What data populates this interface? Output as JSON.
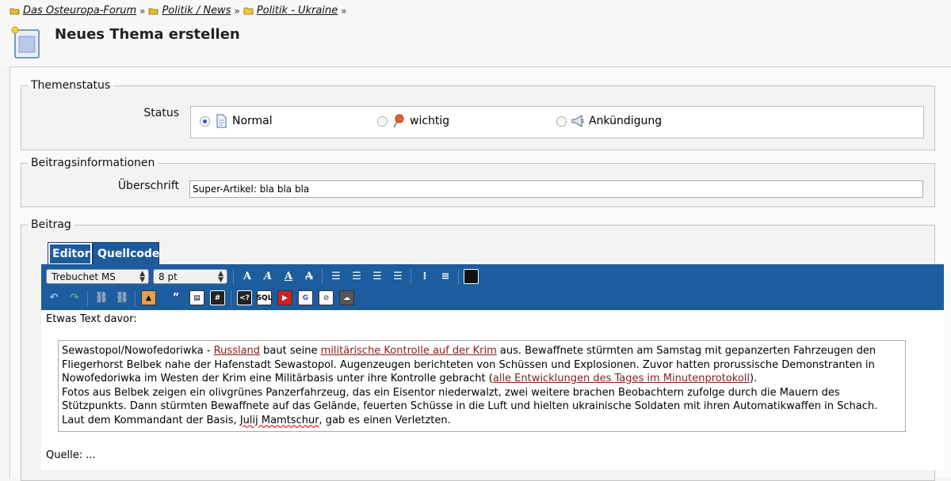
{
  "breadcrumb": {
    "items": [
      "Das Osteuropa-Forum",
      "Politik / News",
      "Politik - Ukraine"
    ],
    "separator": "»"
  },
  "page_title": "Neues Thema erstellen",
  "themenstatus": {
    "legend": "Themenstatus",
    "status_label": "Status",
    "options": [
      {
        "label": "Normal",
        "icon": "document-icon",
        "selected": true
      },
      {
        "label": "wichtig",
        "icon": "pin-icon",
        "selected": false
      },
      {
        "label": "Ankündigung",
        "icon": "megaphone-icon",
        "selected": false
      }
    ]
  },
  "beitragsinfo": {
    "legend": "Beitragsinformationen",
    "subject_label": "Überschrift",
    "subject_value": "Super-Artikel: bla bla bla"
  },
  "beitrag": {
    "legend": "Beitrag",
    "tabs": [
      "Editor",
      "Quellcode"
    ],
    "active_tab": "Editor",
    "font_family": "Trebuchet MS",
    "font_size": "8 pt",
    "toolbar_icons": [
      "bold-icon",
      "italic-icon",
      "underline-icon",
      "strikethrough-icon",
      "align-left-icon",
      "align-center-icon",
      "align-right-icon",
      "justify-icon",
      "bullet-list-icon",
      "numbered-list-icon",
      "color-icon",
      "undo-icon",
      "redo-icon",
      "link-icon",
      "unlink-icon",
      "image-icon",
      "quote-icon",
      "spoiler-icon",
      "hash-icon",
      "code-icon",
      "sql-icon",
      "youtube-icon",
      "google-icon",
      "map-icon",
      "soundcloud-icon"
    ],
    "text_before": "Etwas Text davor:",
    "quote": {
      "p1_a": "Sewastopol/Nowofedoriwka - ",
      "link1": "Russland",
      "p1_b": " baut seine ",
      "link2": "militärische Kontrolle auf der Krim",
      "p1_c": " aus. Bewaffnete stürmten am Samstag mit gepanzerten Fahrzeugen den Fliegerhorst Belbek nahe der Hafenstadt Sewastopol. Augenzeugen berichteten von Schüssen und Explosionen. Zuvor hatten prorussische Demonstranten in Nowofedoriwka im Westen der Krim eine Militärbasis unter ihre Kontrolle gebracht (",
      "link3": "alle Entwicklungen des Tages im Minutenprotokoll",
      "p1_d": ").",
      "p2": "Fotos aus Belbek zeigen ein olivgrünes Panzerfahrzeug, das ein Eisentor niederwalzt, zwei weitere brachen Beobachtern zufolge durch die Mauern des Stützpunkts. Dann stürmten Bewaffnete auf das Gelände, feuerten Schüsse in die Luft und hielten ukrainische Soldaten mit ihren Automatikwaffen in Schach.",
      "p3_a": "Laut dem Kommandant der Basis, ",
      "p3_err": "Julij Mamtschur",
      "p3_b": ", gab es einen Verletzten."
    },
    "text_after": "Quelle: ..."
  }
}
